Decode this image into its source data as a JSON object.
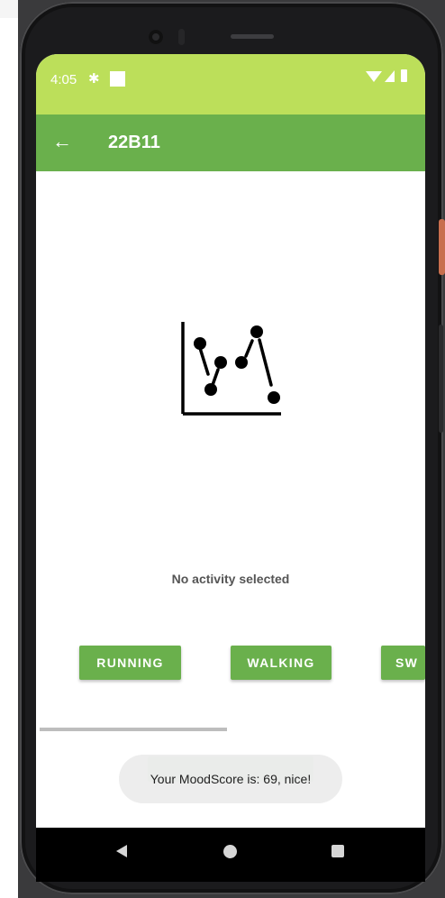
{
  "status_bar": {
    "time": "4:05",
    "gear_glyph": "✱",
    "icons": [
      "settings-icon",
      "square-notification-icon",
      "wifi-icon",
      "signal-icon",
      "battery-icon"
    ],
    "color": "#bcdf5a"
  },
  "app_bar": {
    "back_glyph": "←",
    "title": "22B11",
    "color": "#6ab04c"
  },
  "content": {
    "illustration": "scatter-chart-icon",
    "empty_message": "No activity selected"
  },
  "activities": [
    {
      "label": "RUNNING"
    },
    {
      "label": "WALKING"
    },
    {
      "label": "SW"
    }
  ],
  "toast": {
    "message": "Your MoodScore is: 69, nice!"
  },
  "nav_bar": {
    "icons": [
      "back-icon",
      "home-icon",
      "recents-icon"
    ]
  }
}
